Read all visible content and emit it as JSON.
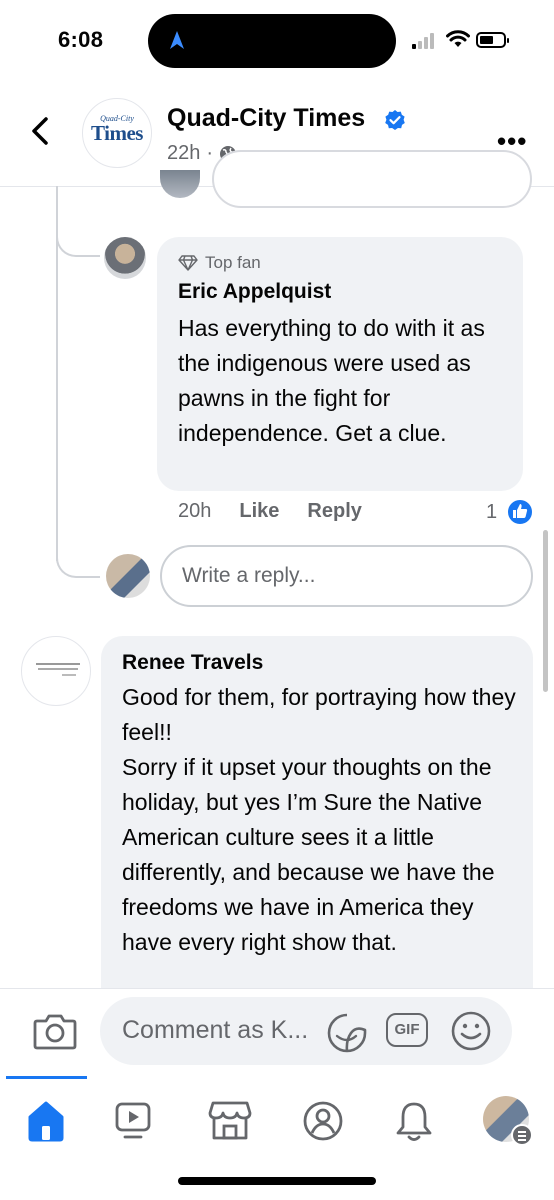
{
  "status_bar": {
    "time": "6:08"
  },
  "header": {
    "page_name": "Quad-City Times",
    "avatar_small": "Quad-City",
    "avatar_big": "Times",
    "meta_time": "22h",
    "meta_sep": "·",
    "verified_icon": "verified-badge-icon",
    "colors": {
      "accent": "#1877f2",
      "brand": "#1e4e8c"
    }
  },
  "comments": [
    {
      "badge": "Top fan",
      "author": "Eric Appelquist",
      "text": "Has everything to do with it as the indigenous were used as pawns in the fight for independence. Get a clue.",
      "time": "20h",
      "like_label": "Like",
      "reply_label": "Reply",
      "reaction_count": "1"
    },
    {
      "author": "Renee Travels",
      "text": "Good for them, for portraying how they feel!!\nSorry if it upset your thoughts on the holiday, but yes I’m Sure the Native American culture sees it a little differently, and because we have the freedoms we have in America they have every right show that."
    }
  ],
  "reply_box": {
    "placeholder": "Write a reply..."
  },
  "composer": {
    "placeholder": "Comment as K...",
    "gif_label": "GIF"
  },
  "tabs": [
    "home",
    "video",
    "marketplace",
    "profile",
    "notifications",
    "menu"
  ]
}
